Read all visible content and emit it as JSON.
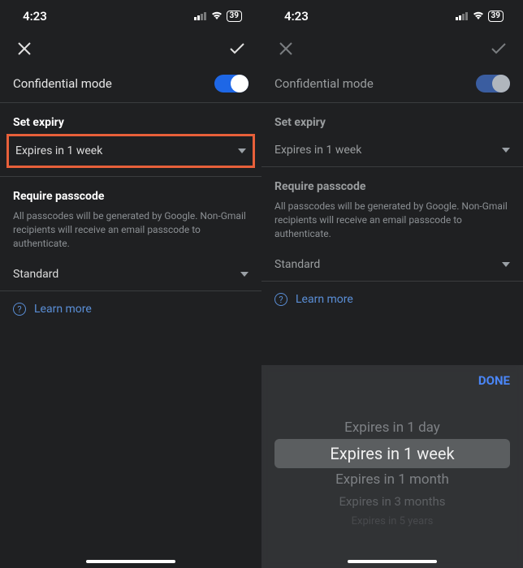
{
  "status": {
    "time": "4:23",
    "battery": "39"
  },
  "header": {
    "confidential_label": "Confidential mode"
  },
  "expiry": {
    "title": "Set expiry",
    "value": "Expires in 1 week"
  },
  "passcode": {
    "title": "Require passcode",
    "desc": "All passcodes will be generated by Google. Non-Gmail recipients will receive an email passcode to authenticate.",
    "value": "Standard"
  },
  "learn_more": "Learn more",
  "picker": {
    "done": "DONE",
    "options": [
      "Expires in 1 day",
      "Expires in 1 week",
      "Expires in 1 month",
      "Expires in 3 months",
      "Expires in 5 years"
    ],
    "selected_index": 1
  }
}
